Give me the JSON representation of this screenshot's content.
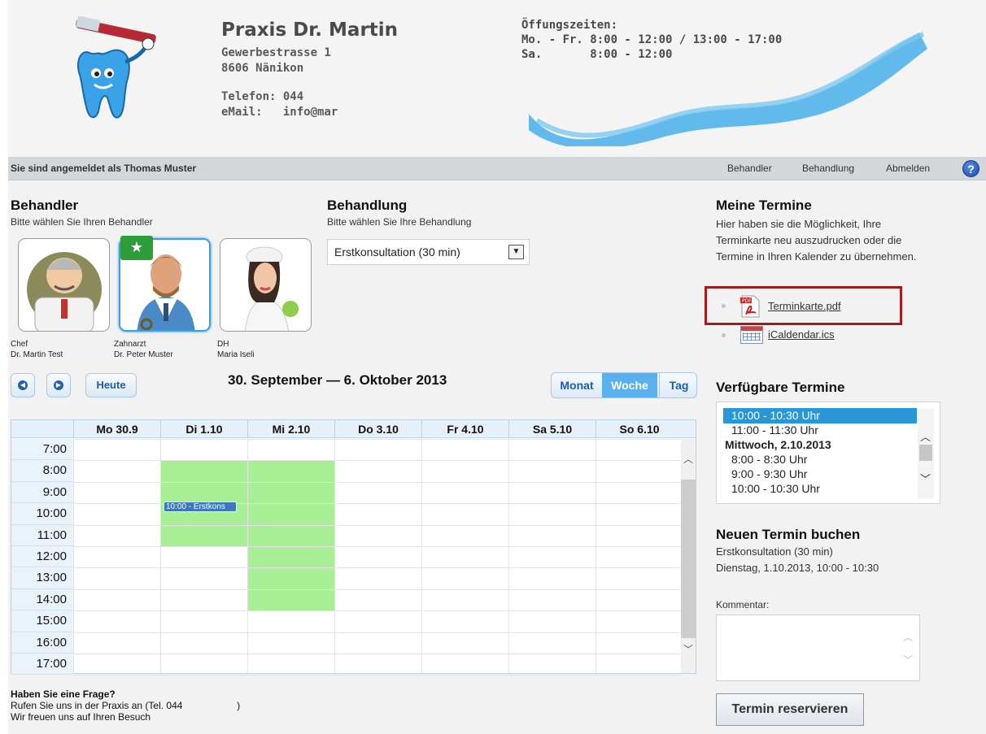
{
  "header": {
    "clinic_name": "Praxis Dr. Martin",
    "street": "Gewerbestrasse 1",
    "city": "8606 Nänikon",
    "phone": "Telefon: 044",
    "email": "eMail:   info@mar",
    "hours_title": "Öffungszeiten:",
    "hours_weekday": "Mo. - Fr. 8:00 - 12:00 / 13:00 - 17:00",
    "hours_saturday": "Sa.       8:00 - 12:00"
  },
  "loginbar": {
    "user_text": "Sie sind angemeldet als Thomas Muster",
    "nav": [
      "Behandler",
      "Behandlung",
      "Abmelden"
    ],
    "help": "?"
  },
  "behandler": {
    "title": "Behandler",
    "subtitle": "Bitte wählen Sie Ihren Behandler",
    "doctors": [
      {
        "role": "Chef",
        "name": "Dr. Martin Test",
        "selected": false
      },
      {
        "role": "Zahnarzt",
        "name": "Dr. Peter Muster",
        "selected": true
      },
      {
        "role": "DH",
        "name": "Maria Iseli",
        "selected": false
      }
    ]
  },
  "behandlung": {
    "title": "Behandlung",
    "subtitle": "Bitte wählen Sie Ihre Behandlung",
    "selected": "Erstkonsultation (30 min)"
  },
  "calendar": {
    "today_label": "Heute",
    "range": "30. September — 6. Oktober 2013",
    "views": [
      "Monat",
      "Woche",
      "Tag"
    ],
    "active_view": "Woche",
    "days": [
      "Mo 30.9",
      "Di 1.10",
      "Mi 2.10",
      "Do 3.10",
      "Fr 4.10",
      "Sa 5.10",
      "So 6.10"
    ],
    "hours": [
      "7:00",
      "8:00",
      "9:00",
      "10:00",
      "11:00",
      "12:00",
      "13:00",
      "14:00",
      "15:00",
      "16:00",
      "17:00"
    ],
    "available": [
      {
        "day": "Di 1.10",
        "from": "8:00",
        "to": "12:00"
      },
      {
        "day": "Mi 2.10",
        "from": "8:00",
        "to": "15:00"
      }
    ],
    "event": {
      "day": "Di 1.10",
      "label": "10:00 - Erstkons"
    },
    "avail_color": "#a8ee94"
  },
  "footer": {
    "question": "Haben Sie eine Frage?",
    "call": "Rufen Sie uns in der Praxis an (Tel. 044                    )",
    "thanks": "Wir freuen uns auf Ihren Besuch"
  },
  "meine_termine": {
    "title": "Meine Termine",
    "text": "Hier haben sie die Möglichkeit, Ihre Terminkarte neu auszudrucken oder die Termine in Ihren Kalender zu übernehmen.",
    "pdf_link": "Terminkarte.pdf",
    "ics_link": "iCaldendar.ics",
    "pdf_icon_text": "PDF"
  },
  "verfuegbare": {
    "title": "Verfügbare Termine",
    "slots": [
      {
        "text": "10:00 - 10:30 Uhr",
        "type": "slot",
        "selected": true
      },
      {
        "text": "11:00 - 11:30 Uhr",
        "type": "slot",
        "selected": false
      },
      {
        "text": "Mittwoch, 2.10.2013",
        "type": "day",
        "selected": false
      },
      {
        "text": "8:00 - 8:30 Uhr",
        "type": "slot",
        "selected": false
      },
      {
        "text": "9:00 - 9:30 Uhr",
        "type": "slot",
        "selected": false
      },
      {
        "text": "10:00 - 10:30 Uhr",
        "type": "slot",
        "selected": false
      }
    ]
  },
  "neuer_termin": {
    "title": "Neuen Termin buchen",
    "treatment": "Erstkonsultation (30 min)",
    "datetime": "Dienstag, 1.10.2013, 10:00 - 10:30",
    "comment_label": "Kommentar:",
    "reserve_label": "Termin reservieren"
  },
  "colors": {
    "accent": "#59b0ec",
    "highlight_border": "#a31d1d",
    "selected_slot": "#2996d6"
  }
}
